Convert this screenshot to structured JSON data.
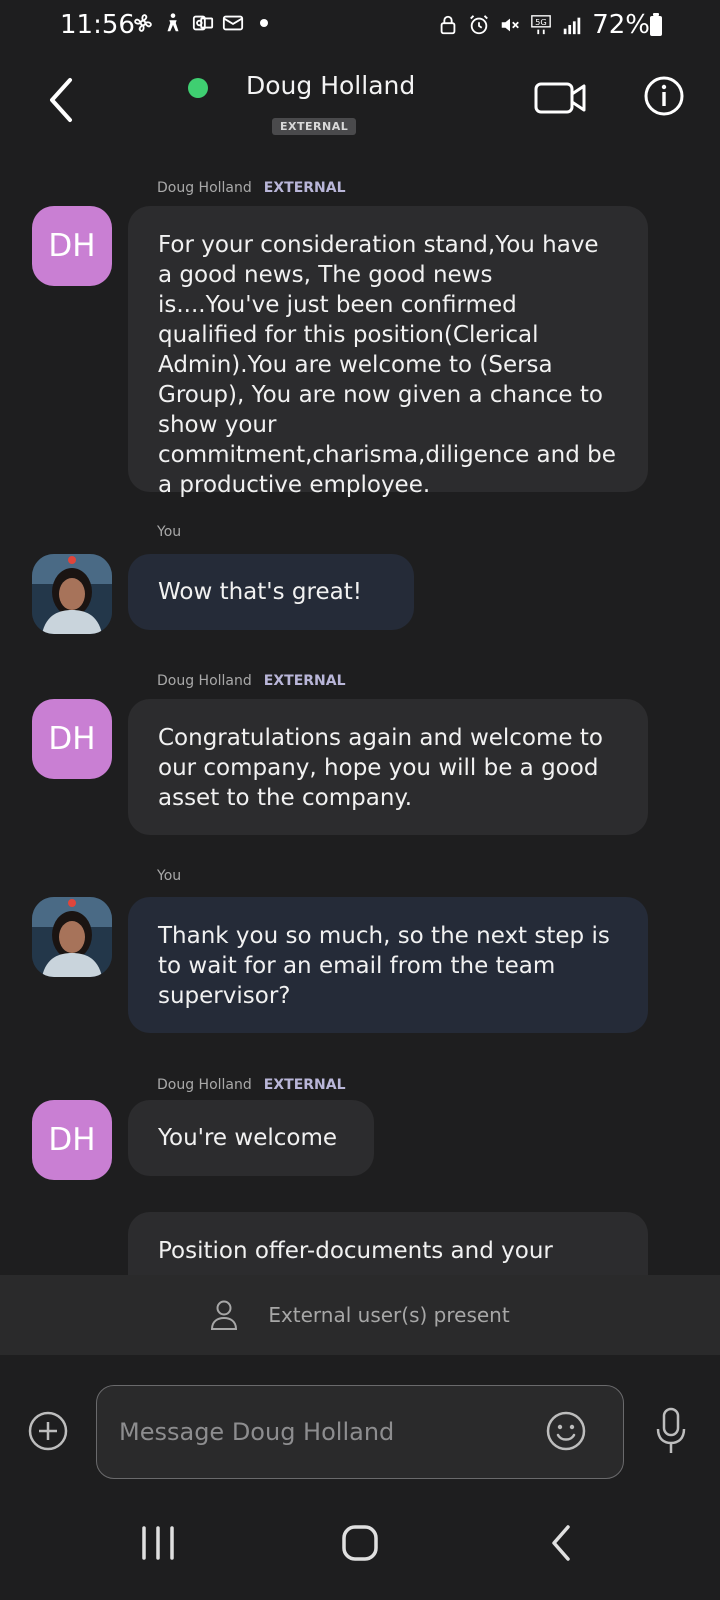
{
  "status_bar": {
    "time": "11:56",
    "battery": "72%",
    "network": "5G",
    "icons": [
      "fan-icon",
      "accessibility-icon",
      "outlook-icon",
      "mail-icon",
      "notification-dot",
      "lock-icon",
      "alarm-icon",
      "mute-icon",
      "5g-icon",
      "signal-icon",
      "battery-icon"
    ]
  },
  "header": {
    "contact_name": "Doug Holland",
    "external_badge": "EXTERNAL",
    "presence_color": "#3fcf71"
  },
  "messages": [
    {
      "sender": "Doug Holland",
      "sender_tag": "EXTERNAL",
      "avatar_initials": "DH",
      "direction": "incoming",
      "text": "For your consideration stand,You have a good news, The good news is....You've just been confirmed qualified for this position(Clerical Admin).You are welcome to (Sersa Group), You are now given a chance to show your commitment,charisma,diligence and be a productive employee."
    },
    {
      "sender": "You",
      "direction": "outgoing",
      "text": "Wow that's great!"
    },
    {
      "sender": "Doug Holland",
      "sender_tag": "EXTERNAL",
      "avatar_initials": "DH",
      "direction": "incoming",
      "text": "Congratulations again and welcome to our company, hope you will be a good asset to the company."
    },
    {
      "sender": "You",
      "direction": "outgoing",
      "text": "Thank you so much, so the next step is to wait for an email from the team supervisor?"
    },
    {
      "sender": "Doug Holland",
      "sender_tag": "EXTERNAL",
      "avatar_initials": "DH",
      "direction": "incoming",
      "text": "You're welcome"
    },
    {
      "direction": "incoming",
      "text": "Position offer-documents and your"
    }
  ],
  "external_notice": {
    "text": "External user(s) present"
  },
  "composer": {
    "placeholder": "Message Doug Holland"
  },
  "colors": {
    "background": "#1e1e1f",
    "incoming_bubble": "#2c2c2e",
    "outgoing_bubble": "#252b38",
    "avatar": "#c97fd3"
  }
}
